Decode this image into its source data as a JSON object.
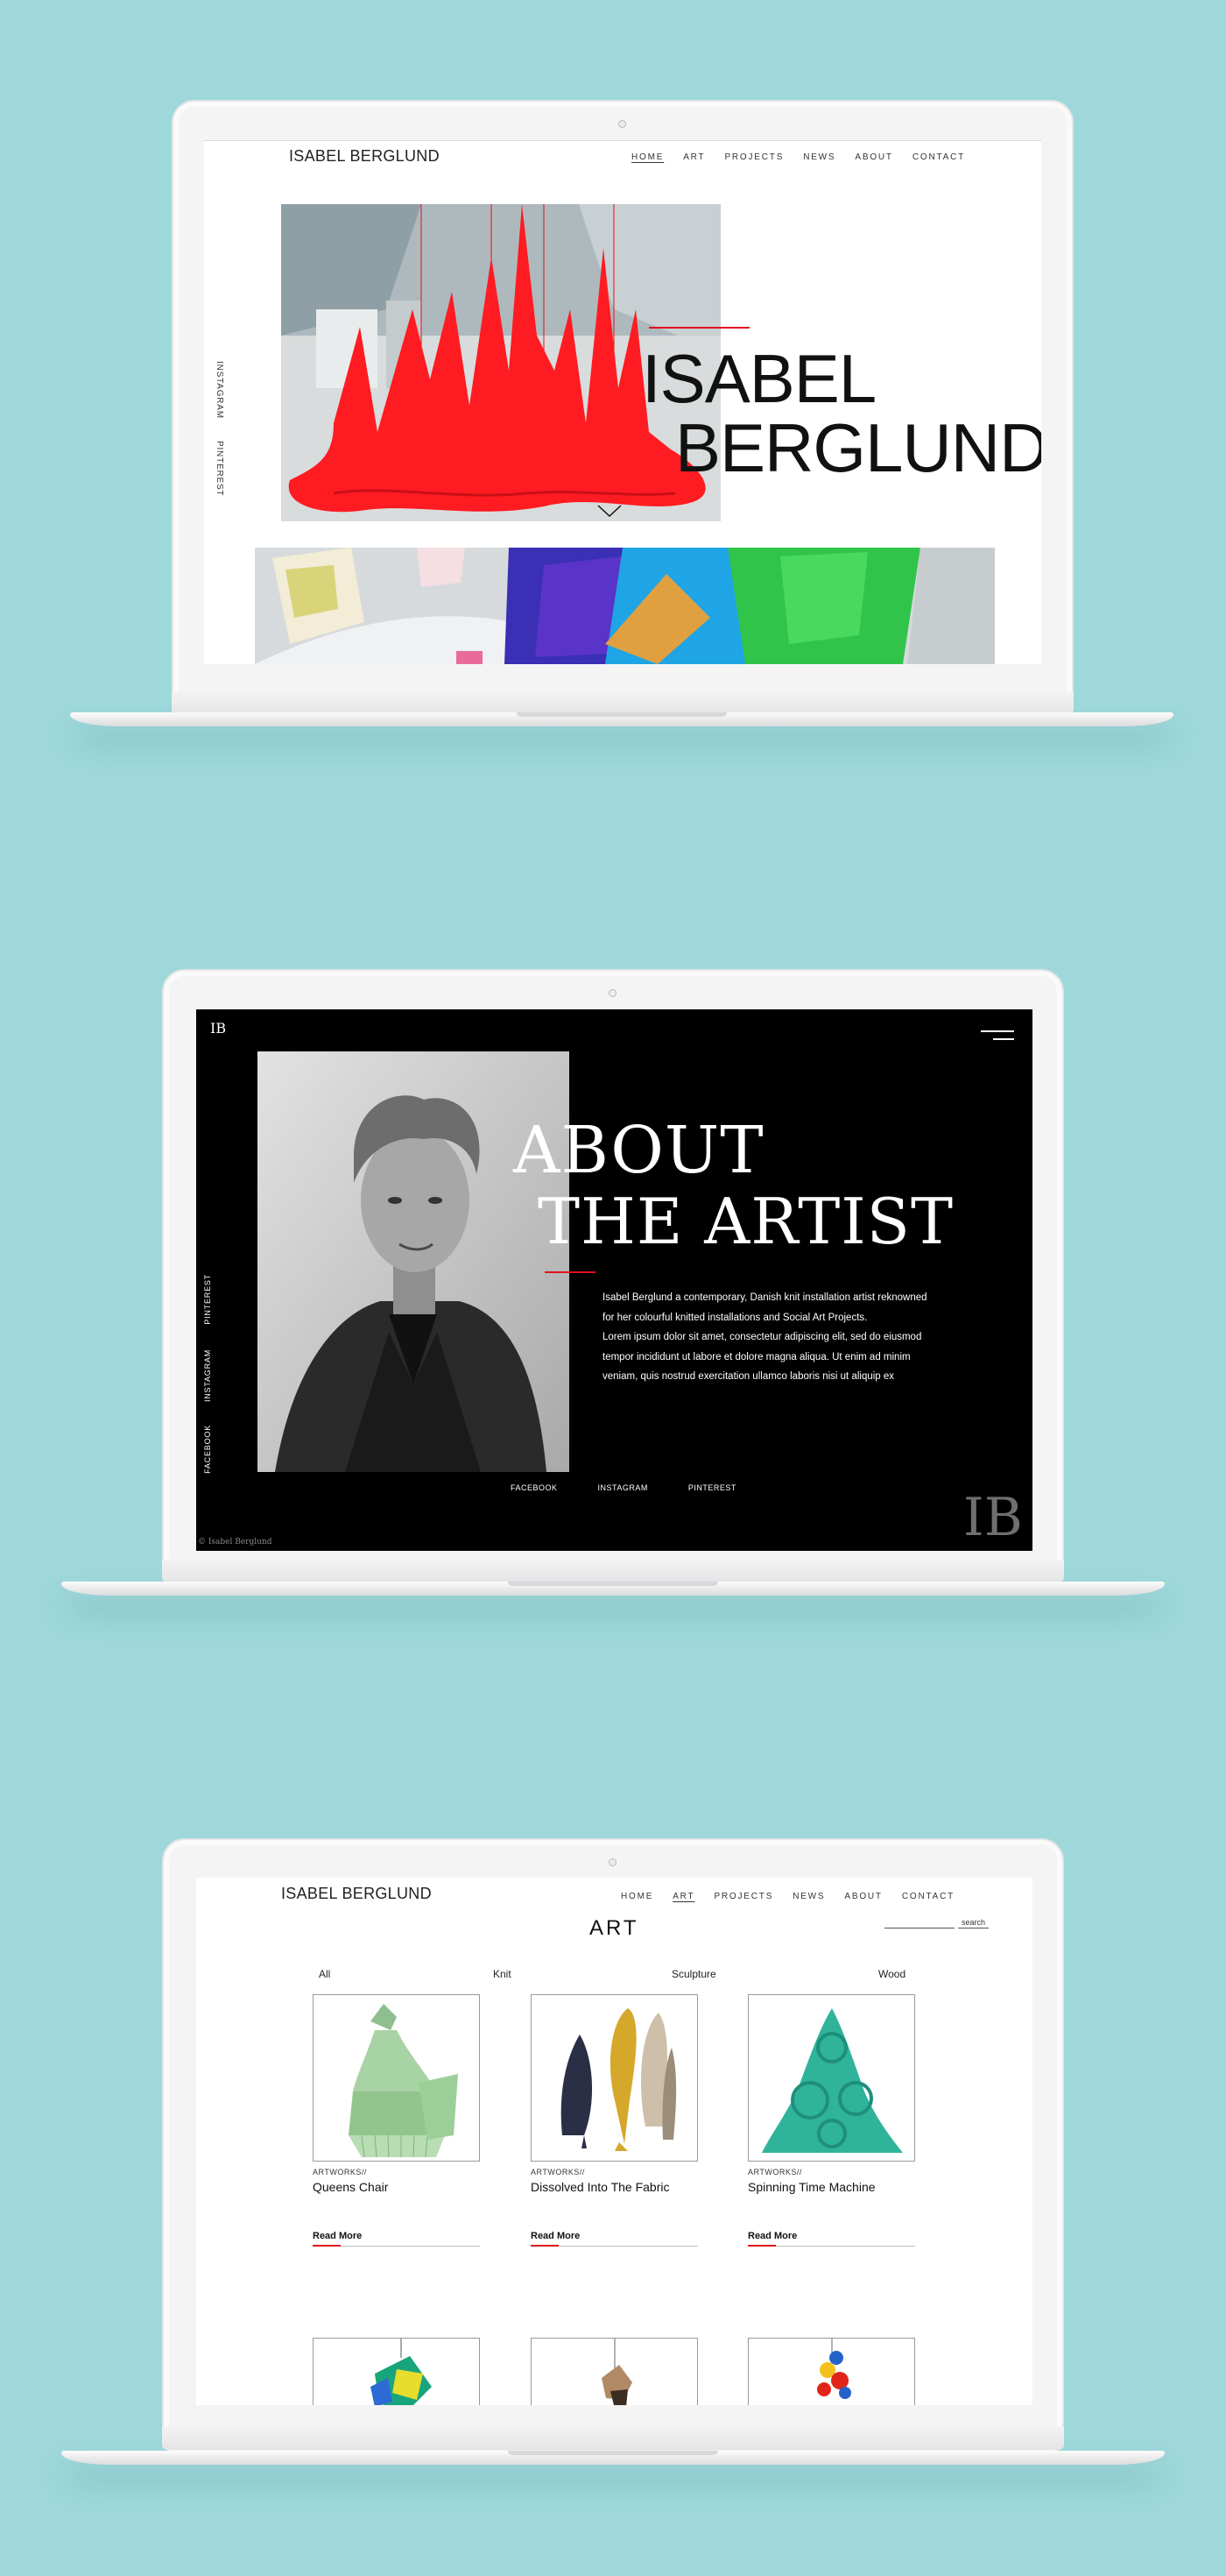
{
  "colors": {
    "background": "#9ed8db",
    "accent_red": "#e3101c",
    "dark_screen": "#000000"
  },
  "home_page": {
    "brand": "ISABEL BERGLUND",
    "nav": [
      {
        "label": "HOME",
        "active": true
      },
      {
        "label": "ART",
        "active": false
      },
      {
        "label": "PROJECTS",
        "active": false
      },
      {
        "label": "NEWS",
        "active": false
      },
      {
        "label": "ABOUT",
        "active": false
      },
      {
        "label": "CONTACT",
        "active": false
      }
    ],
    "side_links": [
      "INSTAGRAM",
      "PINTEREST"
    ],
    "hero_title_line1": "ISABEL",
    "hero_title_line2": "BERGLUND",
    "scroll_icon": "chevron-down-icon"
  },
  "about_page": {
    "logo": "IB",
    "menu_icon": "hamburger-menu-icon",
    "title_line1": "ABOUT",
    "title_line2": "THE ARTIST",
    "paragraph_lines": [
      "Isabel Berglund a contemporary, Danish knit installation artist reknowned",
      "for her colourful knitted installations and Social Art Projects.",
      "Lorem ipsum dolor sit amet, consectetur adipiscing elit, sed do eiusmod",
      "tempor incididunt ut labore et dolore magna aliqua. Ut enim ad minim",
      "veniam, quis nostrud exercitation ullamco laboris nisi ut aliquip ex"
    ],
    "social_links": [
      "FACEBOOK",
      "INSTAGRAM",
      "PINTEREST"
    ],
    "side_links": [
      "PINTEREST",
      "INSTAGRAM",
      "FACEBOOK"
    ],
    "watermark": "IB",
    "copyright": "© Isabel Berglund"
  },
  "art_page": {
    "brand": "ISABEL BERGLUND",
    "nav": [
      {
        "label": "HOME",
        "active": false
      },
      {
        "label": "ART",
        "active": true
      },
      {
        "label": "PROJECTS",
        "active": false
      },
      {
        "label": "NEWS",
        "active": false
      },
      {
        "label": "ABOUT",
        "active": false
      },
      {
        "label": "CONTACT",
        "active": false
      }
    ],
    "heading": "ART",
    "search_label": "search",
    "filters": [
      "All",
      "Knit",
      "Sculpture",
      "Wood"
    ],
    "cards": [
      {
        "kicker": "ARTWORKS//",
        "title": "Queens Chair",
        "link": "Read More"
      },
      {
        "kicker": "ARTWORKS//",
        "title": "Dissolved Into The Fabric",
        "link": "Read More"
      },
      {
        "kicker": "ARTWORKS//",
        "title": "Spinning Time Machine",
        "link": "Read More"
      }
    ]
  }
}
